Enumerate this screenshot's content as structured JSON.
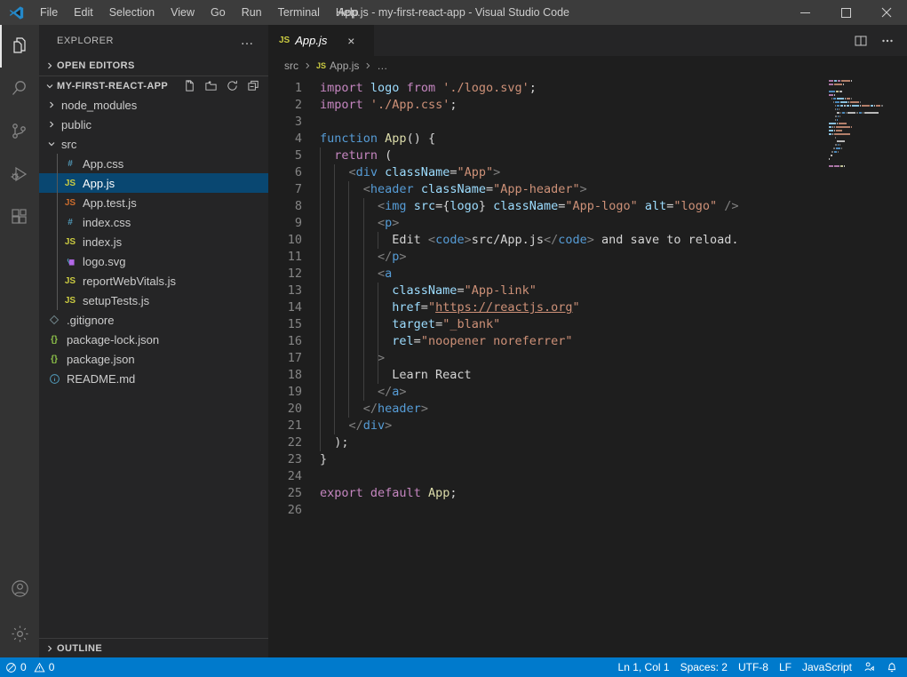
{
  "titlebar": {
    "title": "App.js - my-first-react-app - Visual Studio Code",
    "menus": [
      "File",
      "Edit",
      "Selection",
      "View",
      "Go",
      "Run",
      "Terminal",
      "Help"
    ],
    "window_controls": {
      "minimize": "minimize-icon",
      "maximize": "maximize-icon",
      "close": "close-icon"
    }
  },
  "activitybar": {
    "items": [
      {
        "name": "explorer",
        "icon": "files-icon",
        "active": true
      },
      {
        "name": "search",
        "icon": "search-icon",
        "active": false
      },
      {
        "name": "source-control",
        "icon": "source-control-icon",
        "active": false
      },
      {
        "name": "run-and-debug",
        "icon": "run-debug-icon",
        "active": false
      },
      {
        "name": "extensions",
        "icon": "extensions-icon",
        "active": false
      }
    ],
    "bottom": [
      {
        "name": "accounts",
        "icon": "account-icon"
      },
      {
        "name": "manage",
        "icon": "gear-icon"
      }
    ]
  },
  "sidebar": {
    "title": "EXPLORER",
    "more_actions": "…",
    "open_editors_label": "OPEN EDITORS",
    "folder_label": "MY-FIRST-REACT-APP",
    "folder_actions": [
      "new-file-icon",
      "new-folder-icon",
      "refresh-icon",
      "collapse-all-icon"
    ],
    "outline_label": "OUTLINE",
    "tree": [
      {
        "label": "node_modules",
        "type": "folder",
        "expanded": false,
        "depth": 1,
        "icon": "chevron-right-icon"
      },
      {
        "label": "public",
        "type": "folder",
        "expanded": false,
        "depth": 1,
        "icon": "chevron-right-icon"
      },
      {
        "label": "src",
        "type": "folder",
        "expanded": true,
        "depth": 1,
        "icon": "chevron-down-icon"
      },
      {
        "label": "App.css",
        "type": "file",
        "depth": 2,
        "icon": "css-icon",
        "icon_text": "#",
        "color": "#519aba",
        "selected": false
      },
      {
        "label": "App.js",
        "type": "file",
        "depth": 2,
        "icon": "js-icon",
        "icon_text": "JS",
        "color": "#cbcb41",
        "selected": true
      },
      {
        "label": "App.test.js",
        "type": "file",
        "depth": 2,
        "icon": "js-test-icon",
        "icon_text": "JS",
        "color": "#cc6d2e",
        "selected": false
      },
      {
        "label": "index.css",
        "type": "file",
        "depth": 2,
        "icon": "css-icon",
        "icon_text": "#",
        "color": "#519aba",
        "selected": false
      },
      {
        "label": "index.js",
        "type": "file",
        "depth": 2,
        "icon": "js-icon",
        "icon_text": "JS",
        "color": "#cbcb41",
        "selected": false
      },
      {
        "label": "logo.svg",
        "type": "file",
        "depth": 2,
        "icon": "svg-icon",
        "icon_text": "",
        "color": "#b267e6",
        "selected": false
      },
      {
        "label": "reportWebVitals.js",
        "type": "file",
        "depth": 2,
        "icon": "js-icon",
        "icon_text": "JS",
        "color": "#cbcb41",
        "selected": false
      },
      {
        "label": "setupTests.js",
        "type": "file",
        "depth": 2,
        "icon": "js-icon",
        "icon_text": "JS",
        "color": "#cbcb41",
        "selected": false
      },
      {
        "label": ".gitignore",
        "type": "file",
        "depth": 1,
        "icon": "git-icon",
        "icon_text": "",
        "color": "#6d8086",
        "selected": false
      },
      {
        "label": "package-lock.json",
        "type": "file",
        "depth": 1,
        "icon": "json-icon",
        "icon_text": "{}",
        "color": "#8dc149",
        "selected": false
      },
      {
        "label": "package.json",
        "type": "file",
        "depth": 1,
        "icon": "json-icon",
        "icon_text": "{}",
        "color": "#8dc149",
        "selected": false
      },
      {
        "label": "README.md",
        "type": "file",
        "depth": 1,
        "icon": "info-icon",
        "icon_text": "",
        "color": "#519aba",
        "selected": false
      }
    ]
  },
  "editor": {
    "tab": {
      "label": "App.js",
      "icon_text": "JS",
      "close": "×",
      "preview": true
    },
    "actions": [
      "split-editor-icon",
      "more-actions-icon"
    ],
    "breadcrumb": [
      "src",
      "App.js",
      "…"
    ],
    "breadcrumb_icon_text": "JS",
    "line_count": 26,
    "lines": [
      {
        "n": 1,
        "guides": 0,
        "tokens": [
          {
            "t": "import",
            "c": "t-key"
          },
          {
            "t": " ",
            "c": "t-plain"
          },
          {
            "t": "logo",
            "c": "t-var"
          },
          {
            "t": " ",
            "c": "t-plain"
          },
          {
            "t": "from",
            "c": "t-key"
          },
          {
            "t": " ",
            "c": "t-plain"
          },
          {
            "t": "'./logo.svg'",
            "c": "t-str"
          },
          {
            "t": ";",
            "c": "t-plain"
          }
        ]
      },
      {
        "n": 2,
        "guides": 0,
        "tokens": [
          {
            "t": "import",
            "c": "t-key"
          },
          {
            "t": " ",
            "c": "t-plain"
          },
          {
            "t": "'./App.css'",
            "c": "t-str"
          },
          {
            "t": ";",
            "c": "t-plain"
          }
        ]
      },
      {
        "n": 3,
        "guides": 0,
        "tokens": []
      },
      {
        "n": 4,
        "guides": 0,
        "tokens": [
          {
            "t": "function",
            "c": "t-kw2"
          },
          {
            "t": " ",
            "c": "t-plain"
          },
          {
            "t": "App",
            "c": "t-fn"
          },
          {
            "t": "() {",
            "c": "t-plain"
          }
        ]
      },
      {
        "n": 5,
        "guides": 1,
        "tokens": [
          {
            "t": "  ",
            "c": "t-plain"
          },
          {
            "t": "return",
            "c": "t-key"
          },
          {
            "t": " (",
            "c": "t-plain"
          }
        ]
      },
      {
        "n": 6,
        "guides": 2,
        "tokens": [
          {
            "t": "    <",
            "c": "t-punc"
          },
          {
            "t": "div",
            "c": "t-tag"
          },
          {
            "t": " ",
            "c": "t-plain"
          },
          {
            "t": "className",
            "c": "t-attr"
          },
          {
            "t": "=",
            "c": "t-plain"
          },
          {
            "t": "\"App\"",
            "c": "t-str"
          },
          {
            "t": ">",
            "c": "t-punc"
          }
        ]
      },
      {
        "n": 7,
        "guides": 3,
        "tokens": [
          {
            "t": "      <",
            "c": "t-punc"
          },
          {
            "t": "header",
            "c": "t-tag"
          },
          {
            "t": " ",
            "c": "t-plain"
          },
          {
            "t": "className",
            "c": "t-attr"
          },
          {
            "t": "=",
            "c": "t-plain"
          },
          {
            "t": "\"App-header\"",
            "c": "t-str"
          },
          {
            "t": ">",
            "c": "t-punc"
          }
        ]
      },
      {
        "n": 8,
        "guides": 4,
        "tokens": [
          {
            "t": "        <",
            "c": "t-punc"
          },
          {
            "t": "img",
            "c": "t-tag"
          },
          {
            "t": " ",
            "c": "t-plain"
          },
          {
            "t": "src",
            "c": "t-attr"
          },
          {
            "t": "={",
            "c": "t-plain"
          },
          {
            "t": "logo",
            "c": "t-var"
          },
          {
            "t": "} ",
            "c": "t-plain"
          },
          {
            "t": "className",
            "c": "t-attr"
          },
          {
            "t": "=",
            "c": "t-plain"
          },
          {
            "t": "\"App-logo\"",
            "c": "t-str"
          },
          {
            "t": " ",
            "c": "t-plain"
          },
          {
            "t": "alt",
            "c": "t-attr"
          },
          {
            "t": "=",
            "c": "t-plain"
          },
          {
            "t": "\"logo\"",
            "c": "t-str"
          },
          {
            "t": " ",
            "c": "t-plain"
          },
          {
            "t": "/>",
            "c": "t-punc"
          }
        ]
      },
      {
        "n": 9,
        "guides": 4,
        "tokens": [
          {
            "t": "        <",
            "c": "t-punc"
          },
          {
            "t": "p",
            "c": "t-tag"
          },
          {
            "t": ">",
            "c": "t-punc"
          }
        ]
      },
      {
        "n": 10,
        "guides": 5,
        "tokens": [
          {
            "t": "          Edit ",
            "c": "t-plain"
          },
          {
            "t": "<",
            "c": "t-punc"
          },
          {
            "t": "code",
            "c": "t-tag"
          },
          {
            "t": ">",
            "c": "t-punc"
          },
          {
            "t": "src/App.js",
            "c": "t-plain"
          },
          {
            "t": "</",
            "c": "t-punc"
          },
          {
            "t": "code",
            "c": "t-tag"
          },
          {
            "t": ">",
            "c": "t-punc"
          },
          {
            "t": " and save to reload.",
            "c": "t-plain"
          }
        ]
      },
      {
        "n": 11,
        "guides": 4,
        "tokens": [
          {
            "t": "        </",
            "c": "t-punc"
          },
          {
            "t": "p",
            "c": "t-tag"
          },
          {
            "t": ">",
            "c": "t-punc"
          }
        ]
      },
      {
        "n": 12,
        "guides": 4,
        "tokens": [
          {
            "t": "        <",
            "c": "t-punc"
          },
          {
            "t": "a",
            "c": "t-tag"
          }
        ]
      },
      {
        "n": 13,
        "guides": 5,
        "tokens": [
          {
            "t": "          ",
            "c": "t-plain"
          },
          {
            "t": "className",
            "c": "t-attr"
          },
          {
            "t": "=",
            "c": "t-plain"
          },
          {
            "t": "\"App-link\"",
            "c": "t-str"
          }
        ]
      },
      {
        "n": 14,
        "guides": 5,
        "tokens": [
          {
            "t": "          ",
            "c": "t-plain"
          },
          {
            "t": "href",
            "c": "t-attr"
          },
          {
            "t": "=",
            "c": "t-plain"
          },
          {
            "t": "\"",
            "c": "t-str"
          },
          {
            "t": "https://reactjs.org",
            "c": "t-link"
          },
          {
            "t": "\"",
            "c": "t-str"
          }
        ]
      },
      {
        "n": 15,
        "guides": 5,
        "tokens": [
          {
            "t": "          ",
            "c": "t-plain"
          },
          {
            "t": "target",
            "c": "t-attr"
          },
          {
            "t": "=",
            "c": "t-plain"
          },
          {
            "t": "\"_blank\"",
            "c": "t-str"
          }
        ]
      },
      {
        "n": 16,
        "guides": 5,
        "tokens": [
          {
            "t": "          ",
            "c": "t-plain"
          },
          {
            "t": "rel",
            "c": "t-attr"
          },
          {
            "t": "=",
            "c": "t-plain"
          },
          {
            "t": "\"noopener noreferrer\"",
            "c": "t-str"
          }
        ]
      },
      {
        "n": 17,
        "guides": 5,
        "tokens": [
          {
            "t": "        >",
            "c": "t-punc"
          }
        ]
      },
      {
        "n": 18,
        "guides": 5,
        "tokens": [
          {
            "t": "          Learn React",
            "c": "t-plain"
          }
        ]
      },
      {
        "n": 19,
        "guides": 4,
        "tokens": [
          {
            "t": "        </",
            "c": "t-punc"
          },
          {
            "t": "a",
            "c": "t-tag"
          },
          {
            "t": ">",
            "c": "t-punc"
          }
        ]
      },
      {
        "n": 20,
        "guides": 3,
        "tokens": [
          {
            "t": "      </",
            "c": "t-punc"
          },
          {
            "t": "header",
            "c": "t-tag"
          },
          {
            "t": ">",
            "c": "t-punc"
          }
        ]
      },
      {
        "n": 21,
        "guides": 2,
        "tokens": [
          {
            "t": "    </",
            "c": "t-punc"
          },
          {
            "t": "div",
            "c": "t-tag"
          },
          {
            "t": ">",
            "c": "t-punc"
          }
        ]
      },
      {
        "n": 22,
        "guides": 1,
        "tokens": [
          {
            "t": "  );",
            "c": "t-plain"
          }
        ]
      },
      {
        "n": 23,
        "guides": 0,
        "tokens": [
          {
            "t": "}",
            "c": "t-plain"
          }
        ]
      },
      {
        "n": 24,
        "guides": 0,
        "tokens": []
      },
      {
        "n": 25,
        "guides": 0,
        "tokens": [
          {
            "t": "export",
            "c": "t-key"
          },
          {
            "t": " ",
            "c": "t-plain"
          },
          {
            "t": "default",
            "c": "t-key"
          },
          {
            "t": " ",
            "c": "t-plain"
          },
          {
            "t": "App",
            "c": "t-fn"
          },
          {
            "t": ";",
            "c": "t-plain"
          }
        ]
      },
      {
        "n": 26,
        "guides": 0,
        "tokens": []
      }
    ]
  },
  "statusbar": {
    "errors": "0",
    "warnings": "0",
    "position": "Ln 1, Col 1",
    "indentation": "Spaces: 2",
    "encoding": "UTF-8",
    "eol": "LF",
    "language": "JavaScript",
    "feedback_icon": "feedback-icon",
    "bell_icon": "bell-icon",
    "background": "#007acc"
  },
  "colors": {
    "titlebar_bg": "#3c3c3c",
    "activitybar_bg": "#333333",
    "sidebar_bg": "#252526",
    "editor_bg": "#1e1e1e",
    "selection_blue": "#094771",
    "status_blue": "#007acc",
    "accent_text": "#cccccc"
  }
}
